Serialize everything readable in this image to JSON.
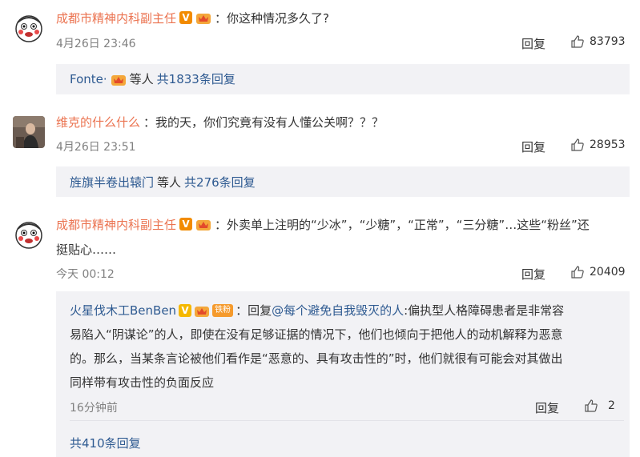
{
  "comments": [
    {
      "user": "成都市精神内科副主任",
      "text": "你这种情况多久了?",
      "time": "4月26日 23:46",
      "reply_label": "回复",
      "likes": "83793",
      "sub_user": "Fonte·",
      "sub_middle": "等人",
      "sub_count": "共1833条回复"
    },
    {
      "user": "维克的什么什么",
      "text": "我的天，你们究竟有没有人懂公关啊？？？",
      "time": "4月26日 23:51",
      "reply_label": "回复",
      "likes": "28953",
      "sub_user": "旌旗半卷出辕门",
      "sub_middle": "等人",
      "sub_count": "共276条回复"
    },
    {
      "user": "成都市精神内科副主任",
      "text_line1": "外卖单上注明的“少冰”，“少糖”，“正常”，“三分糖”…这些“粉丝”还",
      "text_line2": "挺贴心……",
      "time": "今天 00:12",
      "reply_label": "回复",
      "likes": "20409",
      "nested": {
        "user": "火星伐木工BenBen",
        "fans_badge": "铁粉",
        "reply_prefix": "回复",
        "mention": "@每个避免自我毁灭的人",
        "line1": ":偏执型人格障碍患者是非常容",
        "line2": "易陷入“阴谋论”的人，即使在没有足够证据的情况下，他们也倾向于把他人的动机解释为恶意",
        "line3": "的。那么，当某条言论被他们看作是“恶意的、具有攻击性的”时，他们就很有可能会对其做出",
        "line4": "同样带有攻击性的负面反应",
        "time": "16分钟前",
        "reply_label": "回复",
        "likes": "2"
      },
      "more_replies": "共410条回复"
    }
  ],
  "colors": {
    "username": "#eb7350",
    "link": "#2e5a91",
    "sub_bg": "#f2f2f5"
  },
  "icons": [
    "cartoon-avatar",
    "photo-avatar",
    "verified-v-icon",
    "crown-badge-icon",
    "thumb-up-icon"
  ]
}
